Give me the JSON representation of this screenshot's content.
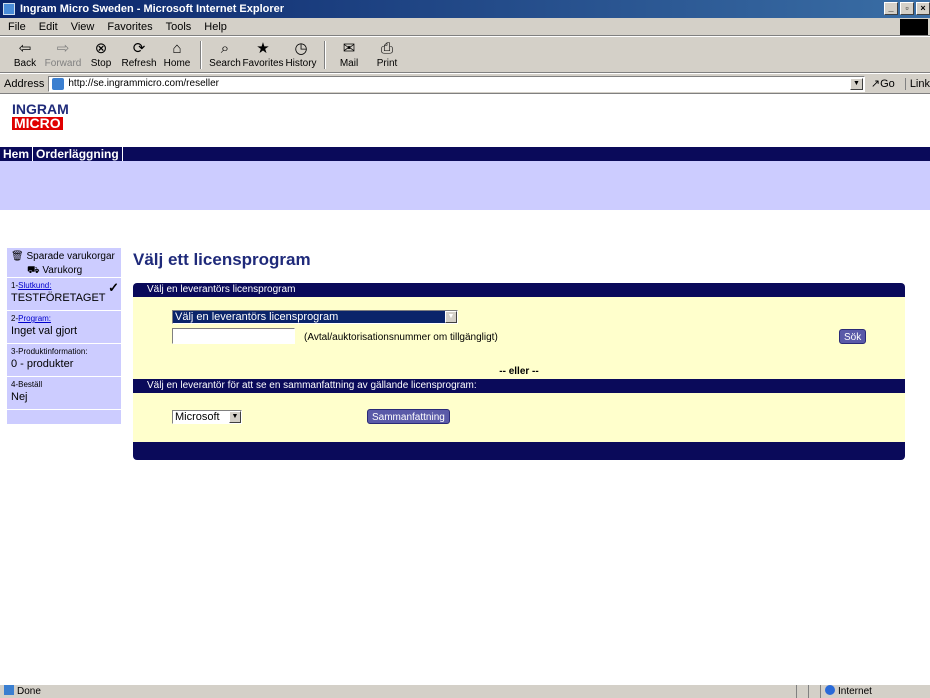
{
  "window": {
    "title": "Ingram Micro Sweden - Microsoft Internet Explorer"
  },
  "menu": [
    "File",
    "Edit",
    "View",
    "Favorites",
    "Tools",
    "Help"
  ],
  "toolbar": [
    {
      "label": "Back",
      "icon": "back-arrow-icon",
      "disabled": false
    },
    {
      "label": "Forward",
      "icon": "forward-arrow-icon",
      "disabled": true
    },
    {
      "label": "Stop",
      "icon": "stop-icon",
      "disabled": false
    },
    {
      "label": "Refresh",
      "icon": "refresh-icon",
      "disabled": false
    },
    {
      "label": "Home",
      "icon": "home-icon",
      "disabled": false
    },
    {
      "label": "Search",
      "icon": "search-icon",
      "disabled": false
    },
    {
      "label": "Favorites",
      "icon": "favorites-icon",
      "disabled": false
    },
    {
      "label": "History",
      "icon": "history-icon",
      "disabled": false
    },
    {
      "label": "Mail",
      "icon": "mail-icon",
      "disabled": false
    },
    {
      "label": "Print",
      "icon": "print-icon",
      "disabled": false
    }
  ],
  "address": {
    "label": "Address",
    "url": "http://se.ingrammicro.com/reseller",
    "go": "Go",
    "links": "Link"
  },
  "logo": {
    "line1": "INGRAM",
    "line2": "MICRO"
  },
  "nav": [
    "Hem",
    "Orderläggning"
  ],
  "sidebar": {
    "saved_carts": "Sparade varukorgar",
    "cart": "Varukorg",
    "steps": [
      {
        "num": "1-",
        "label": "Slutkund:",
        "value": "TESTFÖRETAGET",
        "checked": true
      },
      {
        "num": "2-",
        "label": "Program:",
        "value": "Inget val gjort",
        "checked": false
      },
      {
        "num": "3-",
        "label": "Produktinformation:",
        "value": "0 - produkter",
        "checked": false
      },
      {
        "num": "4-",
        "label": "Beställ",
        "value": "Nej",
        "checked": false
      }
    ]
  },
  "main": {
    "title": "Välj ett licensprogram",
    "section1_header": "Välj en leverantörs licensprogram",
    "select1_value": "Välj en leverantörs licensprogram",
    "agreement_input_value": "",
    "agreement_hint": "(Avtal/auktorisationsnummer om tillgängligt)",
    "search_button": "Sök",
    "or_label": "-- eller --",
    "section2_header": "Välj en leverantör för att se en sammanfattning av gällande licensprogram:",
    "vendor_select_value": "Microsoft",
    "summary_button": "Sammanfattning"
  },
  "status": {
    "text": "Done",
    "zone": "Internet"
  }
}
